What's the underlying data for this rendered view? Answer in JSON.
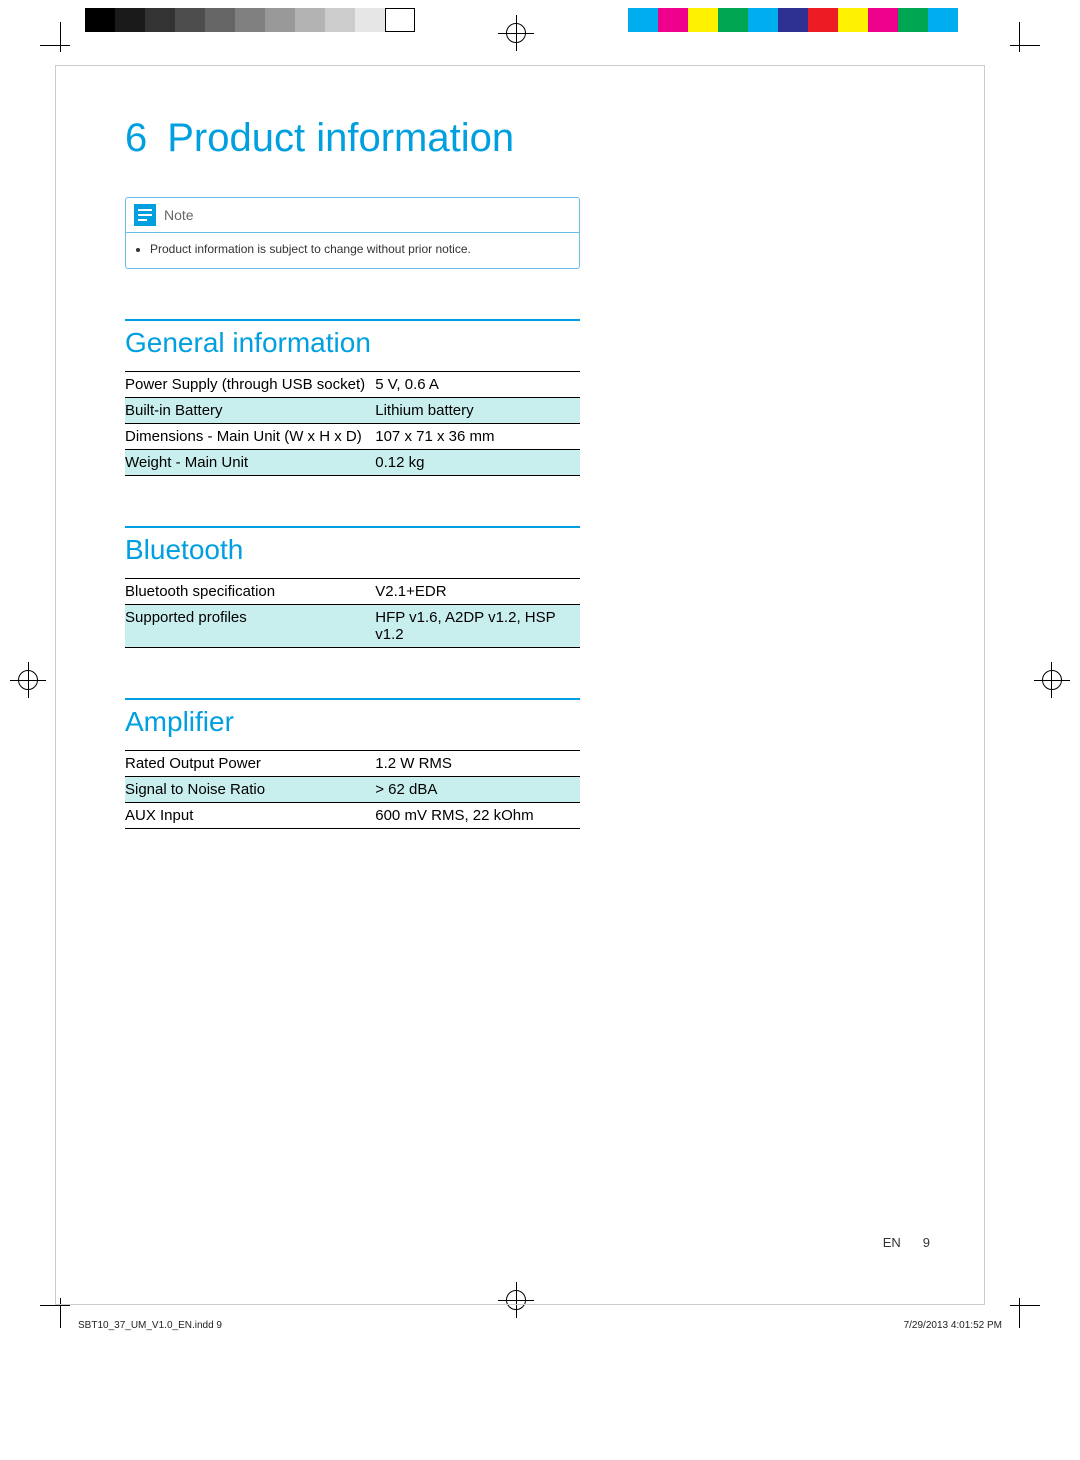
{
  "print": {
    "greyscale": [
      "#000000",
      "#1a1a1a",
      "#333333",
      "#4d4d4d",
      "#666666",
      "#808080",
      "#999999",
      "#b3b3b3",
      "#cccccc",
      "#e6e6e6",
      "#ffffff"
    ],
    "colorbar": [
      "#00aeef",
      "#ec008c",
      "#fff200",
      "#00a651",
      "#00aeef",
      "#2e3192",
      "#ed1c24",
      "#fff200",
      "#ec008c",
      "#00a651",
      "#00aeef"
    ]
  },
  "chapter": {
    "number": "6",
    "title": "Product information"
  },
  "note": {
    "label": "Note",
    "text": "Product information is subject to change without prior notice."
  },
  "sections": {
    "general": {
      "title": "General information",
      "rows": [
        {
          "k": "Power Supply (through USB socket)",
          "v": "5 V, 0.6 A"
        },
        {
          "k": "Built-in Battery",
          "v": "Lithium battery"
        },
        {
          "k": "Dimensions - Main Unit (W x H x D)",
          "v": "107 x 71 x 36 mm"
        },
        {
          "k": "Weight - Main Unit",
          "v": "0.12 kg"
        }
      ]
    },
    "bluetooth": {
      "title": "Bluetooth",
      "rows": [
        {
          "k": "Bluetooth specification",
          "v": "V2.1+EDR"
        },
        {
          "k": "Supported profiles",
          "v": "HFP v1.6, A2DP v1.2, HSP v1.2"
        }
      ]
    },
    "amplifier": {
      "title": "Amplifier",
      "rows": [
        {
          "k": "Rated Output Power",
          "v": "1.2 W RMS"
        },
        {
          "k": "Signal to Noise Ratio",
          "v": "> 62 dBA"
        },
        {
          "k": "AUX Input",
          "v": "600 mV RMS, 22 kOhm"
        }
      ]
    }
  },
  "footer": {
    "lang": "EN",
    "page": "9"
  },
  "slug": {
    "left": "SBT10_37_UM_V1.0_EN.indd   9",
    "right": "7/29/2013   4:01:52 PM"
  }
}
